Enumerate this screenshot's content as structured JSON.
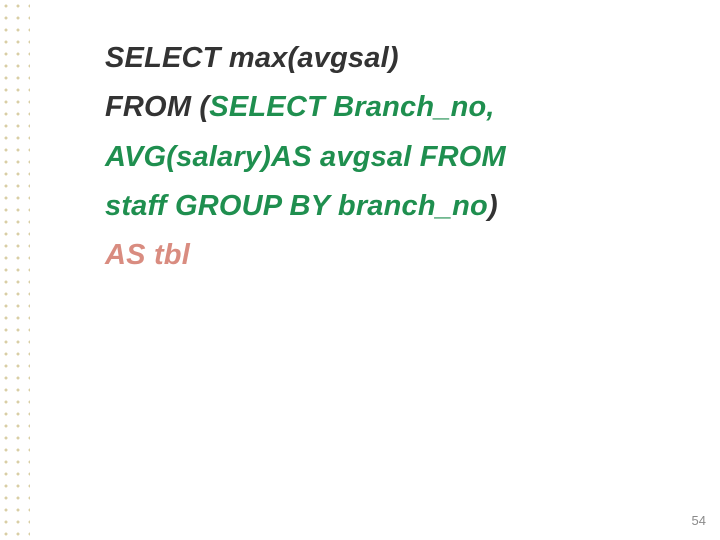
{
  "slide": {
    "lines": [
      {
        "parts": [
          {
            "text": "SELECT   max(avgsal)",
            "cls": "dark"
          }
        ]
      },
      {
        "parts": [
          {
            "text": "FROM (",
            "cls": "dark"
          },
          {
            "text": "SELECT Branch_no,",
            "cls": "green"
          }
        ]
      },
      {
        "parts": [
          {
            "text": "AVG(salary)AS avgsal FROM",
            "cls": "green"
          }
        ]
      },
      {
        "parts": [
          {
            "text": "staff GROUP BY branch_no",
            "cls": "green"
          },
          {
            "text": ")",
            "cls": "dark"
          }
        ]
      },
      {
        "parts": [
          {
            "text": "AS tbl",
            "cls": "salmon"
          }
        ]
      }
    ],
    "page_number": "54"
  }
}
